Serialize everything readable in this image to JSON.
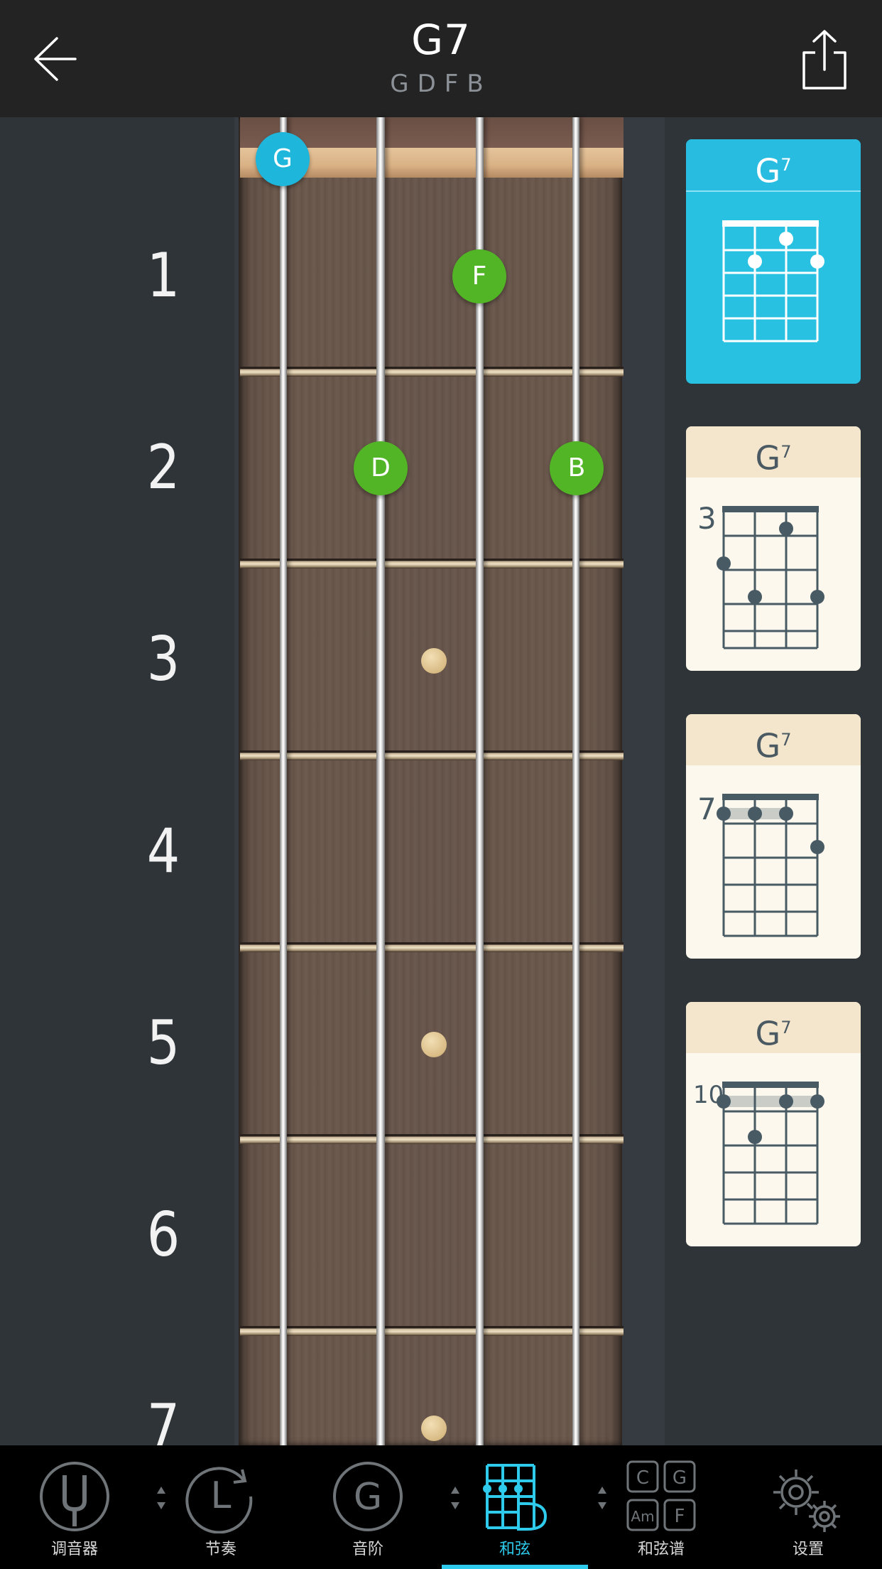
{
  "header": {
    "title": "G7",
    "notes": "GDFB",
    "back_icon": "arrow-left-icon",
    "share_icon": "share-icon"
  },
  "fret_numbers": [
    "1",
    "2",
    "3",
    "4",
    "5",
    "6",
    "7"
  ],
  "notes_on_fretboard": [
    {
      "label": "G",
      "string": 1,
      "fret": 0,
      "type": "root"
    },
    {
      "label": "F",
      "string": 3,
      "fret": 1,
      "type": "chord"
    },
    {
      "label": "D",
      "string": 2,
      "fret": 2,
      "type": "chord"
    },
    {
      "label": "B",
      "string": 4,
      "fret": 2,
      "type": "chord"
    }
  ],
  "chord_cards": [
    {
      "name": "G",
      "sup": "7",
      "start_fret": "",
      "active": true
    },
    {
      "name": "G",
      "sup": "7",
      "start_fret": "3",
      "active": false
    },
    {
      "name": "G",
      "sup": "7",
      "start_fret": "7",
      "active": false
    },
    {
      "name": "G",
      "sup": "7",
      "start_fret": "10",
      "active": false
    }
  ],
  "nav": {
    "tuner": "调音器",
    "rhythm": "节奏",
    "rhythm_letter": "L",
    "scale": "音阶",
    "scale_letter": "G",
    "chord": "和弦",
    "chord_chart": "和弦谱",
    "settings": "设置",
    "chart_letters": [
      "C",
      "G",
      "Am",
      "F"
    ]
  },
  "colors": {
    "accent": "#2ecbec",
    "root_note": "#1fb6dc",
    "chord_note": "#52b526",
    "header_bg": "#232323"
  }
}
